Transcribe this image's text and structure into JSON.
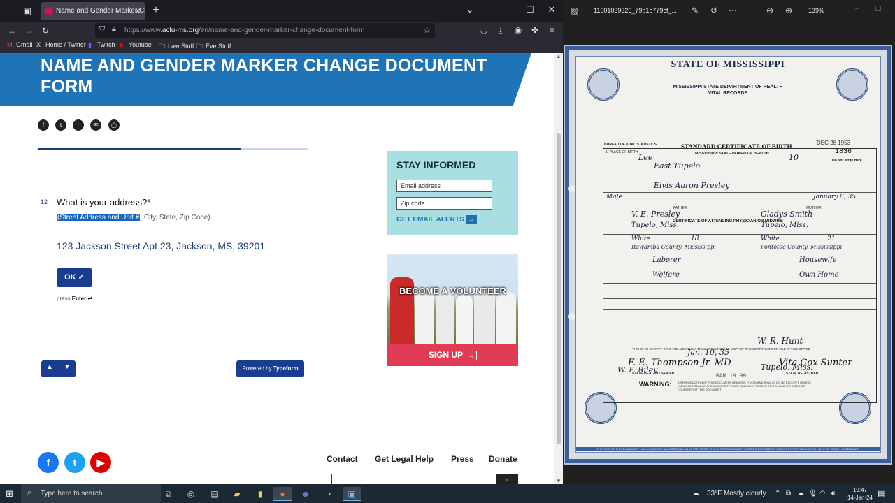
{
  "browser": {
    "tab_title": "Name and Gender Marker Chan",
    "url_prefix": "https://www.",
    "url_domain": "aclu-ms.org",
    "url_path": "/en/name-and-gender-marker-change-document-form",
    "bookmarks": [
      "Gmail",
      "Home / Twitter",
      "Twitch",
      "Youtube",
      "Law Stuff",
      "Eve Stuff"
    ]
  },
  "page": {
    "banner_title": "NAME AND GENDER MARKER CHANGE DOCUMENT FORM",
    "progress_fraction": 0.75,
    "question_number": "12→",
    "question_text": "What is your address?*",
    "help_selected": "(Street Address and Unit #",
    "help_rest": ", City, State, Zip Code)",
    "answer_value": "123 Jackson Street Apt 23, Jackson, MS, 39201",
    "ok_label": "OK ✓",
    "press_label": "press",
    "press_key": "Enter ↵",
    "powered_prefix": "Powered by",
    "powered_brand": "Typeform"
  },
  "sidebar": {
    "stay_title": "STAY INFORMED",
    "email_placeholder": "Email address",
    "zip_placeholder": "Zip code",
    "alerts_label": "GET EMAIL ALERTS",
    "volunteer_title": "BECOME A VOLUNTEER",
    "signup_label": "SIGN UP"
  },
  "footer": {
    "links": [
      "Contact",
      "Get Legal Help",
      "Press",
      "Donate"
    ]
  },
  "viewer": {
    "filename": "11601039326_79b1b779cf_...",
    "zoom": "139%"
  },
  "certificate": {
    "state_header": "STATE OF MISSISSIPPI",
    "dept_line1": "MISSISSIPPI STATE DEPARTMENT OF HEALTH",
    "dept_line2": "VITAL RECORDS",
    "bureau": "BUREAU OF VITAL STATISTICS",
    "std_title": "STANDARD CERTIFICATE OF BIRTH",
    "std_sub": "MISSISSIPPI STATE BOARD OF HEALTH",
    "stamp_date": "DEC 28 1953",
    "file_no": "1836",
    "do_not_write": "Do Not Write Here",
    "place_of_birth": "1. PLACE OF BIRTH",
    "county": "Lee",
    "town": "East Tupelo",
    "reg_no": "10",
    "child_name": "Elvis Aaron Presley",
    "sex": "Male",
    "birth_date": "January 8, 35",
    "father_header": "FATHER",
    "mother_header": "MOTHER",
    "father_name": "V. E. Presley",
    "mother_name": "Gladys Smith",
    "father_res": "Tupelo, Miss.",
    "mother_res": "Tupelo, Miss.",
    "father_color": "White",
    "mother_color": "White",
    "father_age": "18",
    "mother_age": "21",
    "father_birthplace": "Itawamba County, Mississippi",
    "mother_birthplace": "Pontotoc County, Mississippi",
    "father_occupation": "Laborer",
    "mother_occupation": "Housewife",
    "father_industry": "Welfare",
    "mother_industry": "Own Home",
    "attending_header": "CERTIFICATE OF ATTENDING PHYSICIAN OR MIDWIFE",
    "physician": "W. R. Hunt",
    "physician_address": "Tupelo, Miss.",
    "filed": "Jan. 10, 35",
    "registrar": "W. F. Riley",
    "certify_text": "THIS IS TO CERTIFY THAT THE ABOVE IS A TRUE AND CORRECT COPY OF THE CERTIFICATE ON FILE IN THIS OFFICE",
    "health_officer_sig": "F. E. Thompson Jr. MD",
    "health_officer_caption": "STATE HEALTH OFFICER",
    "registrar_sig": "Vita Cox Sunter",
    "registrar_caption": "STATE REGISTRAR",
    "issue_date": "MAR 19 99",
    "warning_label": "WARNING:",
    "warning_text": "A REPRODUCTION OF THIS DOCUMENT RENDERS IT VOID AND INVALID. DO NOT ACCEPT UNLESS EMBOSSED SEAL OF THE MISSISSIPPI STATE BOARD IS PRESENT. IT IS ILLEGAL TO ALTER OR COUNTERFEIT THIS DOCUMENT",
    "bottom_strip": "THE FACE OF THIS DOCUMENT HAS A COLORED BACKGROUND ON WHITE PAPER. THIS IS WATERMARKED PAPER DO NOT ACCEPT WITHOUT FIRST HOLDING TO LIGHT TO VERIFY WATERMARK"
  },
  "taskbar": {
    "search_placeholder": "Type here to search",
    "weather": "33°F  Mostly cloudy",
    "time": "19:47",
    "date": "14-Jan-24"
  }
}
